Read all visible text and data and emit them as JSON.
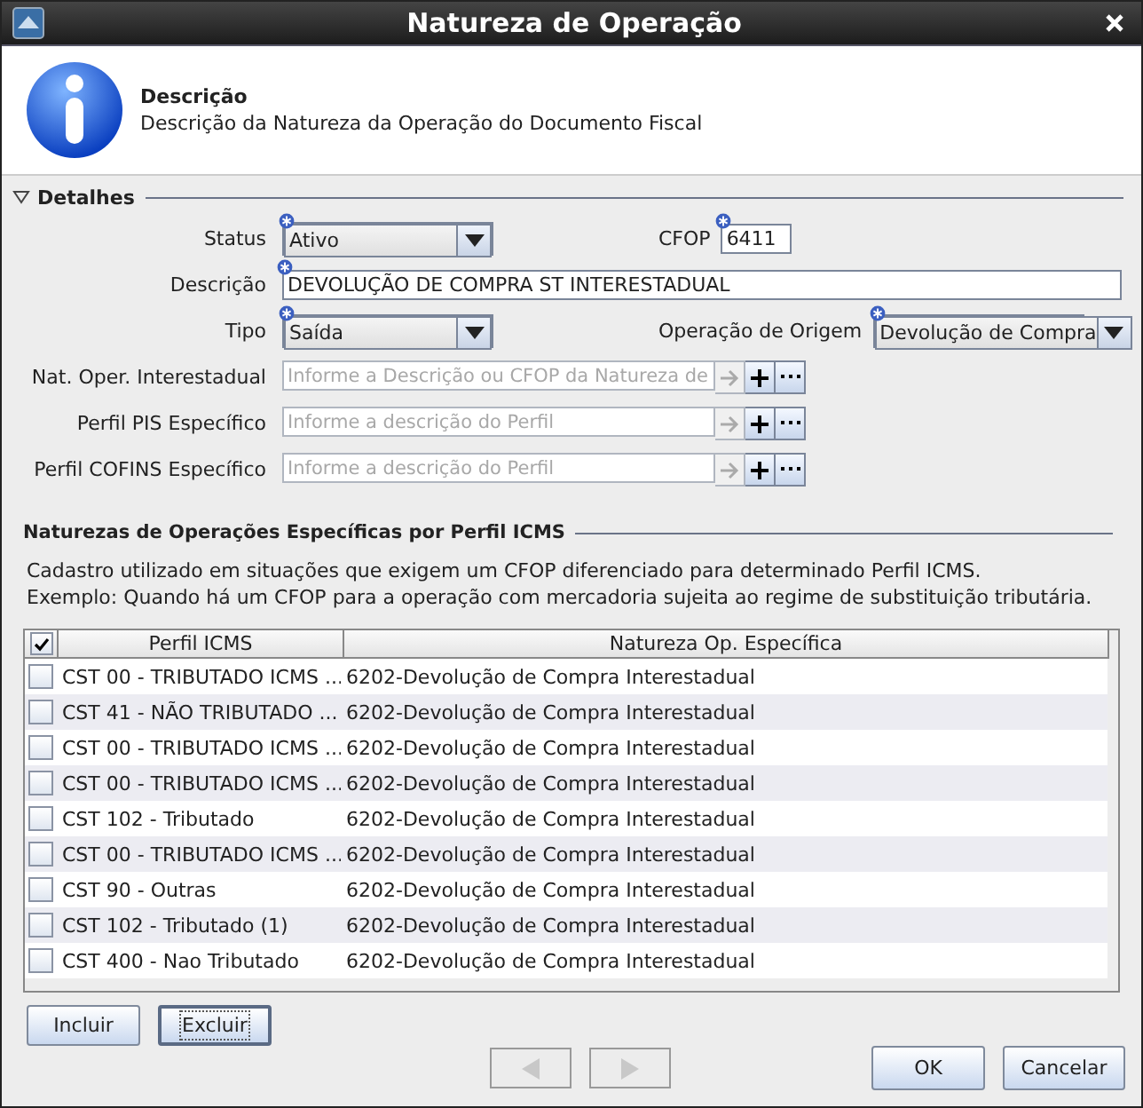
{
  "window": {
    "title": "Natureza de Operação"
  },
  "header": {
    "title": "Descrição",
    "subtitle": "Descrição da Natureza da Operação do Documento Fiscal"
  },
  "section": {
    "title": "Detalhes",
    "expanded": true
  },
  "form_rows": [
    {
      "fields": [
        {
          "label": "Status",
          "kind": "combo",
          "value": "Ativo",
          "required": true
        },
        {
          "label": "CFOP",
          "kind": "text",
          "value": "6411",
          "required": true
        }
      ]
    },
    {
      "fields": [
        {
          "label": "Descrição",
          "kind": "wide",
          "value": "DEVOLUÇÃO DE COMPRA ST INTERESTADUAL",
          "required": true
        }
      ]
    },
    {
      "fields": [
        {
          "label": "Tipo",
          "kind": "combo",
          "value": "Saída",
          "required": true
        },
        {
          "label": "Operação de Origem",
          "kind": "combo",
          "value": "Devolução de Compra",
          "required": true
        }
      ]
    },
    {
      "fields": [
        {
          "label": "Nat. Oper. Interestadual",
          "kind": "lookup",
          "placeholder": "Informe a Descrição ou CFOP da Natureza de",
          "required": false
        }
      ]
    },
    {
      "fields": [
        {
          "label": "Perfil PIS Específico",
          "kind": "lookup",
          "placeholder": "Informe a descrição do Perfil",
          "required": false
        }
      ]
    },
    {
      "fields": [
        {
          "label": "Perfil COFINS Específico",
          "kind": "lookup",
          "placeholder": "Informe a descrição do Perfil",
          "required": false
        }
      ]
    }
  ],
  "subsection": {
    "title": "Naturezas de Operações Específicas por Perfil ICMS",
    "lines": [
      "Cadastro utilizado em situações que exigem um CFOP diferenciado para determinado Perfil ICMS.",
      "Exemplo: Quando há um CFOP para a operação com mercadoria sujeita ao regime de substituição tributária."
    ]
  },
  "table": {
    "select_all": {
      "checked": true
    },
    "columns": [
      "Perfil ICMS",
      "Natureza Op. Específica"
    ],
    "rows": [
      {
        "checked": false,
        "cells": [
          "CST 00 - TRIBUTADO ICMS ...",
          "6202-Devolução de Compra Interestadual"
        ]
      },
      {
        "checked": false,
        "cells": [
          "CST 41 - NÃO TRIBUTADO ...",
          "6202-Devolução de Compra Interestadual"
        ]
      },
      {
        "checked": false,
        "cells": [
          "CST 00 - TRIBUTADO ICMS ...",
          "6202-Devolução de Compra Interestadual"
        ]
      },
      {
        "checked": false,
        "cells": [
          "CST 00 - TRIBUTADO ICMS ...",
          "6202-Devolução de Compra Interestadual"
        ]
      },
      {
        "checked": false,
        "cells": [
          "CST 102 - Tributado",
          "6202-Devolução de Compra Interestadual"
        ]
      },
      {
        "checked": false,
        "cells": [
          "CST 00 - TRIBUTADO ICMS ...",
          "6202-Devolução de Compra Interestadual"
        ]
      },
      {
        "checked": false,
        "cells": [
          "CST 90 - Outras",
          "6202-Devolução de Compra Interestadual"
        ]
      },
      {
        "checked": false,
        "cells": [
          "CST 102 - Tributado (1)",
          "6202-Devolução de Compra Interestadual"
        ]
      },
      {
        "checked": false,
        "cells": [
          "CST 400 - Nao Tributado",
          "6202-Devolução de Compra Interestadual"
        ]
      }
    ]
  },
  "table_buttons": [
    {
      "label": "Incluir",
      "focused": false
    },
    {
      "label": "Excluir",
      "focused": true
    }
  ],
  "nav_buttons": [
    {
      "kind": "previous",
      "disabled": true
    },
    {
      "kind": "next",
      "disabled": true
    }
  ],
  "buttons": [
    "OK",
    "Cancelar"
  ]
}
